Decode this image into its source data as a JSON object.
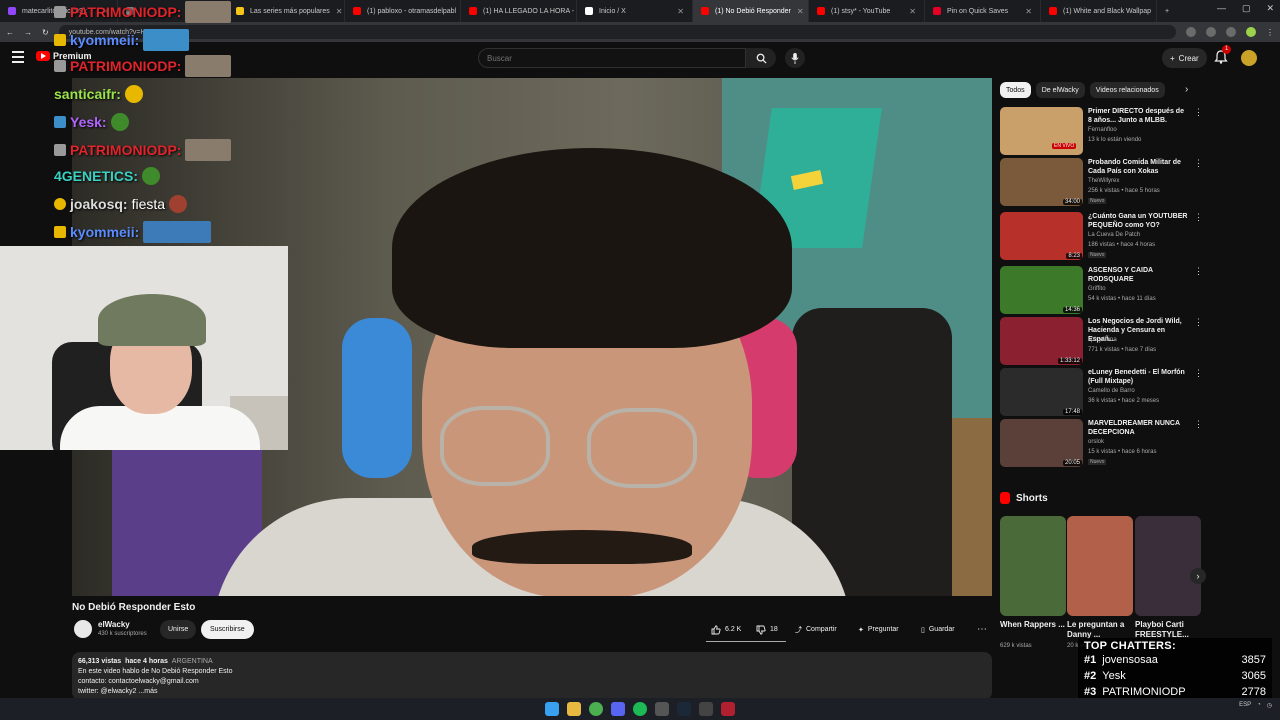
{
  "browser": {
    "tabs": [
      {
        "title": "matecarlitosmicro Sk",
        "color": "#9147ff"
      },
      {
        "title": "",
        "color": "#888888"
      },
      {
        "title": "Las series más populares",
        "color": "#f5c518"
      },
      {
        "title": "(1) pabloxo - otramasdelpabl",
        "color": "#ff0000"
      },
      {
        "title": "(1) HA LLEGADO LA HORA -",
        "color": "#ff0000"
      },
      {
        "title": "Inicio / X",
        "color": "#ffffff"
      },
      {
        "title": "(1) No Debió Responder",
        "color": "#ff0000"
      },
      {
        "title": "(1) stsy* - YouTube",
        "color": "#ff0000"
      },
      {
        "title": "Pin on Quick Saves",
        "color": "#e60023"
      },
      {
        "title": "(1) White and Black Wallpap",
        "color": "#ff0000"
      }
    ],
    "new_tab": "+",
    "url": "youtube.com/watch?v=HI"
  },
  "youtube": {
    "logo": "Premium",
    "search_placeholder": "Buscar",
    "create_label": "Crear",
    "notif_count": "1"
  },
  "stream_chat": [
    {
      "user": "PATRIMONIODP:",
      "color": "#e0242b",
      "msg": ""
    },
    {
      "user": "kyommeii:",
      "color": "#5b8cff",
      "msg": ""
    },
    {
      "user": "PATRIMONIODP:",
      "color": "#e0242b",
      "msg": ""
    },
    {
      "user": "santicaifr:",
      "color": "#9be34a",
      "msg": ""
    },
    {
      "user": "Yesk:",
      "color": "#b065ff",
      "msg": ""
    },
    {
      "user": "PATRIMONIODP:",
      "color": "#e0242b",
      "msg": ""
    },
    {
      "user": "4GENETICS:",
      "color": "#3ad0c3",
      "msg": ""
    },
    {
      "user": "joakosq:",
      "color": "#dcdcdc",
      "msg": "fiesta"
    },
    {
      "user": "kyommeii:",
      "color": "#5b8cff",
      "msg": ""
    }
  ],
  "video": {
    "title": "No Debió Responder Esto",
    "channel": "elWacky",
    "subscribers": "430 k suscriptores",
    "join": "Unirse",
    "subscribe": "Suscribirse",
    "likes": "6.2 K",
    "dislikes": "18",
    "share": "Compartir",
    "ask": "Preguntar",
    "save": "Guardar",
    "more": "⋯",
    "views": "66,313 vistas",
    "age": "hace 4 horas",
    "country": "ARGENTINA",
    "desc_line1": "En este video hablo de No Debió Responder Esto",
    "desc_line2": "contacto: contactoelwacky@gmail.com",
    "desc_line3": "twitter: @elwacky2 ...más"
  },
  "sidebar": {
    "chips": [
      "Todos",
      "De elWacky",
      "Videos relacionados"
    ],
    "recommendations": [
      {
        "title": "Primer DIRECTO después de 8 años... Junto a MLBB.",
        "channel": "Fernanfloo",
        "meta": "13 k lo están viendo",
        "badge": "",
        "duration": "",
        "live": "EN VIVO",
        "color": "#c9a06a"
      },
      {
        "title": "Probando Comida Militar de Cada País con Xokas",
        "channel": "TheWillyrex",
        "meta": "256 k vistas • hace 5 horas",
        "badge": "Nuevo",
        "duration": "34:00",
        "live": "",
        "color": "#7a5a3a"
      },
      {
        "title": "¿Cuánto Gana un YOUTUBER PEQUEÑO como YO?",
        "channel": "La Cueva De Patch",
        "meta": "186 vistas • hace 4 horas",
        "badge": "Nuevo",
        "duration": "8:23",
        "live": "",
        "color": "#b8302a"
      },
      {
        "title": "ASCENSO Y CAIDA RODSQUARE",
        "channel": "Griffito",
        "meta": "54 k vistas • hace 11 días",
        "badge": "",
        "duration": "14:36",
        "live": "",
        "color": "#3c7a2a"
      },
      {
        "title": "Los Negocios de Jordi Wild, Hacienda y Censura en Españ...",
        "channel": "spicy4tuna",
        "meta": "771 k vistas • hace 7 días",
        "badge": "",
        "duration": "1:33:12",
        "live": "",
        "color": "#8a2030"
      },
      {
        "title": "eLuney Benedetti - El Morfón (Full Mixtape)",
        "channel": "Camello de Barro",
        "meta": "36 k vistas • hace 2 meses",
        "badge": "",
        "duration": "17:48",
        "live": "",
        "color": "#2b2b2b"
      },
      {
        "title": "MARVELDREAMER NUNCA DECEPCIONA",
        "channel": "orslok",
        "meta": "15 k vistas • hace 6 horas",
        "badge": "Nuevo",
        "duration": "20:05",
        "live": "",
        "color": "#5a4038"
      }
    ],
    "shorts_label": "Shorts",
    "shorts": [
      {
        "title": "When Rappers ...",
        "views": "629 k vistas",
        "color": "#4a6a3a"
      },
      {
        "title": "Le preguntan a Danny ...",
        "views": "20 k vistas",
        "color": "#b2604a"
      },
      {
        "title": "Playboi Carti FREESTYLE...",
        "views": "",
        "color": "#3a2e3a"
      }
    ]
  },
  "top_chatters": {
    "title": "TOP CHATTERS:",
    "rows": [
      {
        "rank": "#1",
        "name": "jovensosaa",
        "count": "3857"
      },
      {
        "rank": "#2",
        "name": "Yesk",
        "count": "3065"
      },
      {
        "rank": "#3",
        "name": "PATRIMONIODP",
        "count": "2778"
      }
    ]
  }
}
